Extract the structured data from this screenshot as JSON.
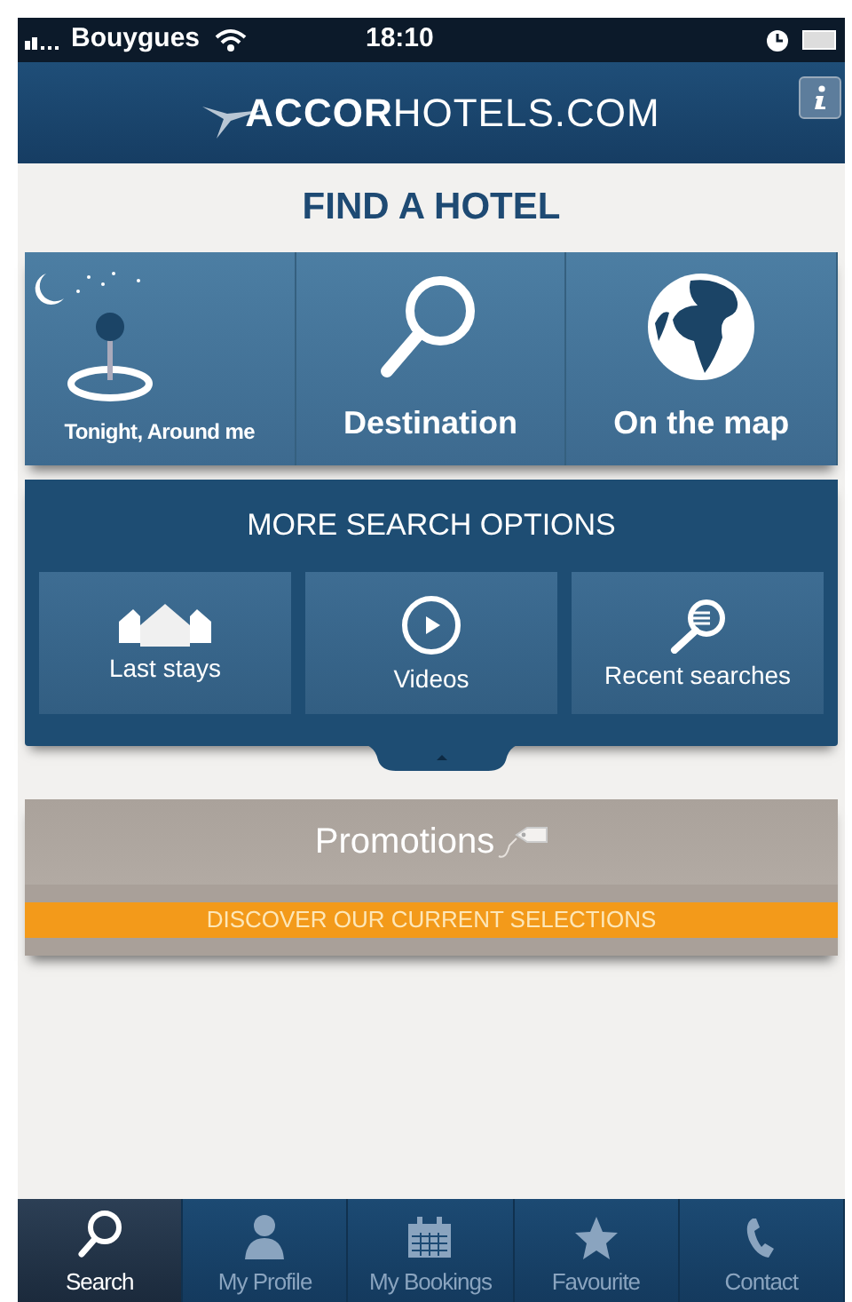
{
  "status_bar": {
    "carrier": "Bouygues",
    "time": "18:10"
  },
  "header": {
    "logo": "**ACCOR**HOTELS.COM"
  },
  "title": "FIND A HOTEL",
  "quick_search": [
    {
      "label": "Tonight, Around me"
    },
    {
      "label": "Destination"
    },
    {
      "label": "On the map"
    }
  ],
  "more_options": {
    "title": "MORE SEARCH OPTIONS",
    "items": [
      {
        "label": "Last stays"
      },
      {
        "label": "Videos"
      },
      {
        "label": "Recent searches"
      }
    ]
  },
  "promotions": {
    "title": "Promotions",
    "banner": "DISCOVER OUR CURRENT SELECTIONS"
  },
  "tab_bar": [
    {
      "label": "Search",
      "selected": true
    },
    {
      "label": "My Profile",
      "selected": false
    },
    {
      "label": "My Bookings",
      "selected": false
    },
    {
      "label": "Favourite",
      "selected": false
    },
    {
      "label": "Contact",
      "selected": false
    }
  ]
}
